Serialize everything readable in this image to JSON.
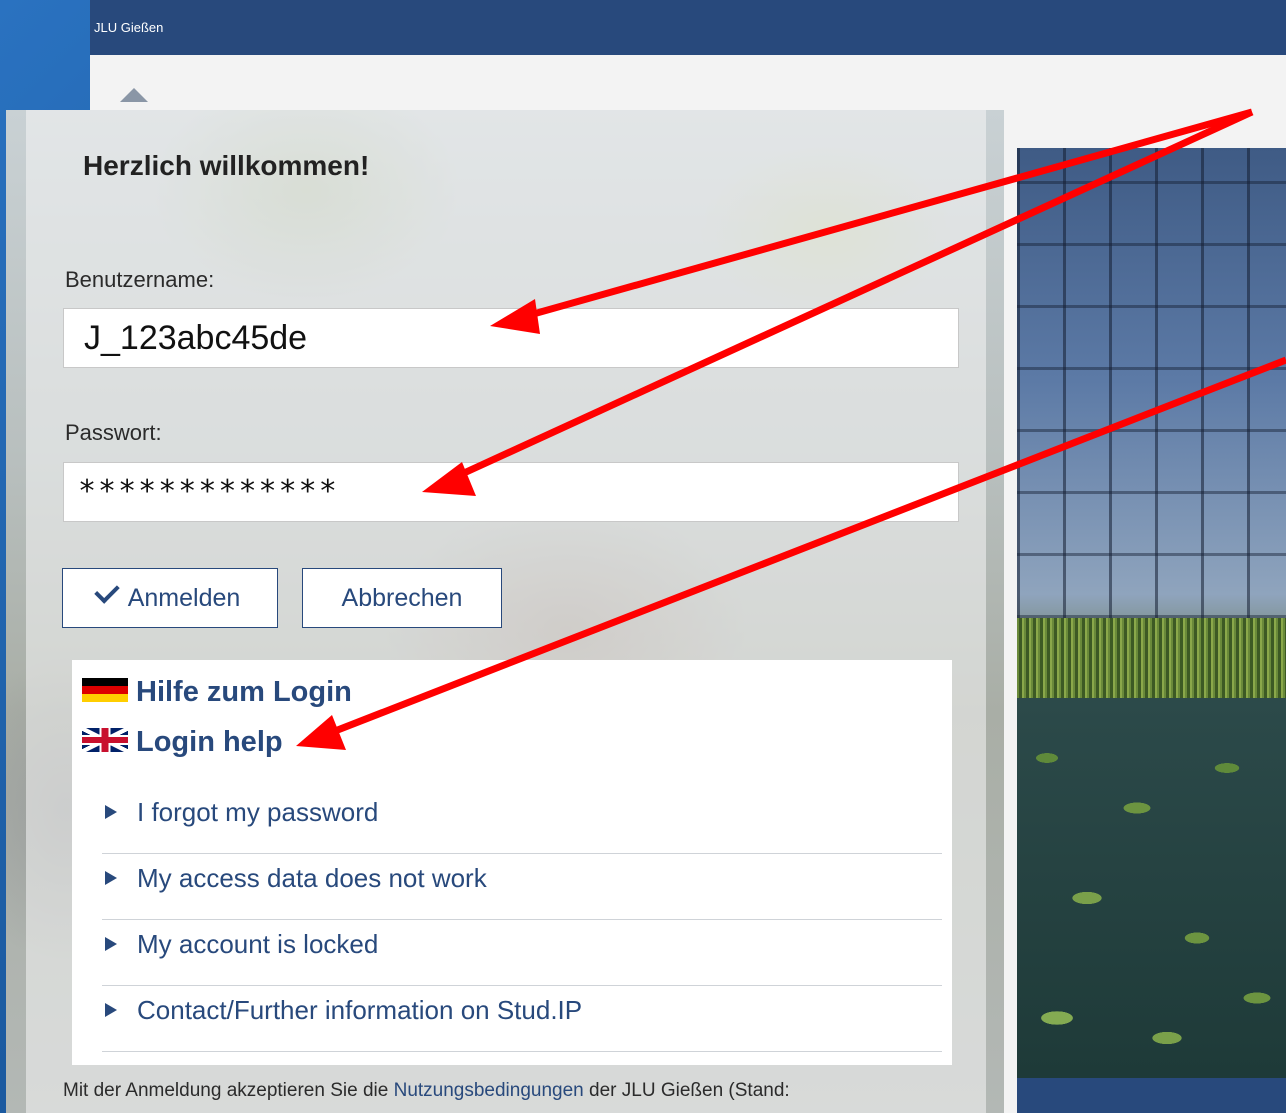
{
  "header": {
    "brand": "JLU Gießen"
  },
  "login": {
    "welcome": "Herzlich willkommen!",
    "username_label": "Benutzername:",
    "username_value": "J_123abc45de",
    "password_label": "Passwort:",
    "password_value": "*************",
    "login_button": "Anmelden",
    "cancel_button": "Abbrechen"
  },
  "help": {
    "title_de": "Hilfe zum Login",
    "title_en": "Login help",
    "items": [
      {
        "label": "I forgot my password"
      },
      {
        "label": "My access data does not work"
      },
      {
        "label": "My account is locked"
      },
      {
        "label": "Contact/Further information on Stud.IP"
      }
    ]
  },
  "footer": {
    "terms_prefix": "Mit der Anmeldung akzeptieren Sie die ",
    "terms_link": "Nutzungsbedingungen",
    "terms_suffix": " der JLU Gießen (Stand:"
  },
  "colors": {
    "accent": "#28497c",
    "annotation": "#ff0000"
  }
}
